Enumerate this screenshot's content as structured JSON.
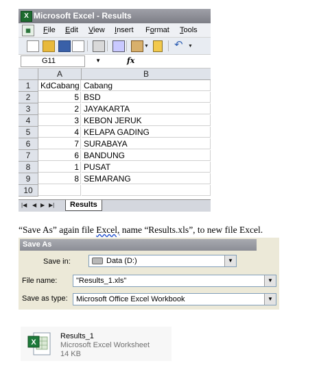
{
  "excel": {
    "window_title": "Microsoft Excel - Results",
    "menu": [
      "File",
      "Edit",
      "View",
      "Insert",
      "Format",
      "Tools"
    ],
    "menu_underline": [
      "F",
      "E",
      "V",
      "I",
      "o",
      "T"
    ],
    "name_box": "G11",
    "fx_label": "fx",
    "columns": [
      "A",
      "B"
    ],
    "rows": [
      {
        "n": "1",
        "a": "KdCabang",
        "b": "Cabang"
      },
      {
        "n": "2",
        "a": "5",
        "b": "BSD"
      },
      {
        "n": "3",
        "a": "2",
        "b": "JAYAKARTA"
      },
      {
        "n": "4",
        "a": "3",
        "b": "KEBON JERUK"
      },
      {
        "n": "5",
        "a": "4",
        "b": "KELAPA GADING"
      },
      {
        "n": "6",
        "a": "7",
        "b": "SURABAYA"
      },
      {
        "n": "7",
        "a": "6",
        "b": "BANDUNG"
      },
      {
        "n": "8",
        "a": "1",
        "b": "PUSAT"
      },
      {
        "n": "9",
        "a": "8",
        "b": "SEMARANG"
      },
      {
        "n": "10",
        "a": "",
        "b": ""
      }
    ],
    "sheet_tab": "Results"
  },
  "caption": {
    "before": "“Save As” again file ",
    "underlined": "Excel,",
    "after": " name “Results.xls”, to new file Excel."
  },
  "save_as": {
    "title": "Save As",
    "save_in_label": "Save in:",
    "save_in_value": "Data (D:)",
    "file_name_label": "File name:",
    "file_name_value": "\"Results_1.xls\"",
    "save_as_type_label": "Save as type:",
    "save_as_type_value": "Microsoft Office Excel Workbook"
  },
  "file_item": {
    "name": "Results_1",
    "type": "Microsoft Excel Worksheet",
    "size": "14 KB"
  },
  "colors": {
    "excel_green": "#1d6b2f",
    "header_gray": "#dfe3ea",
    "dialog_bg": "#ece9d8"
  }
}
